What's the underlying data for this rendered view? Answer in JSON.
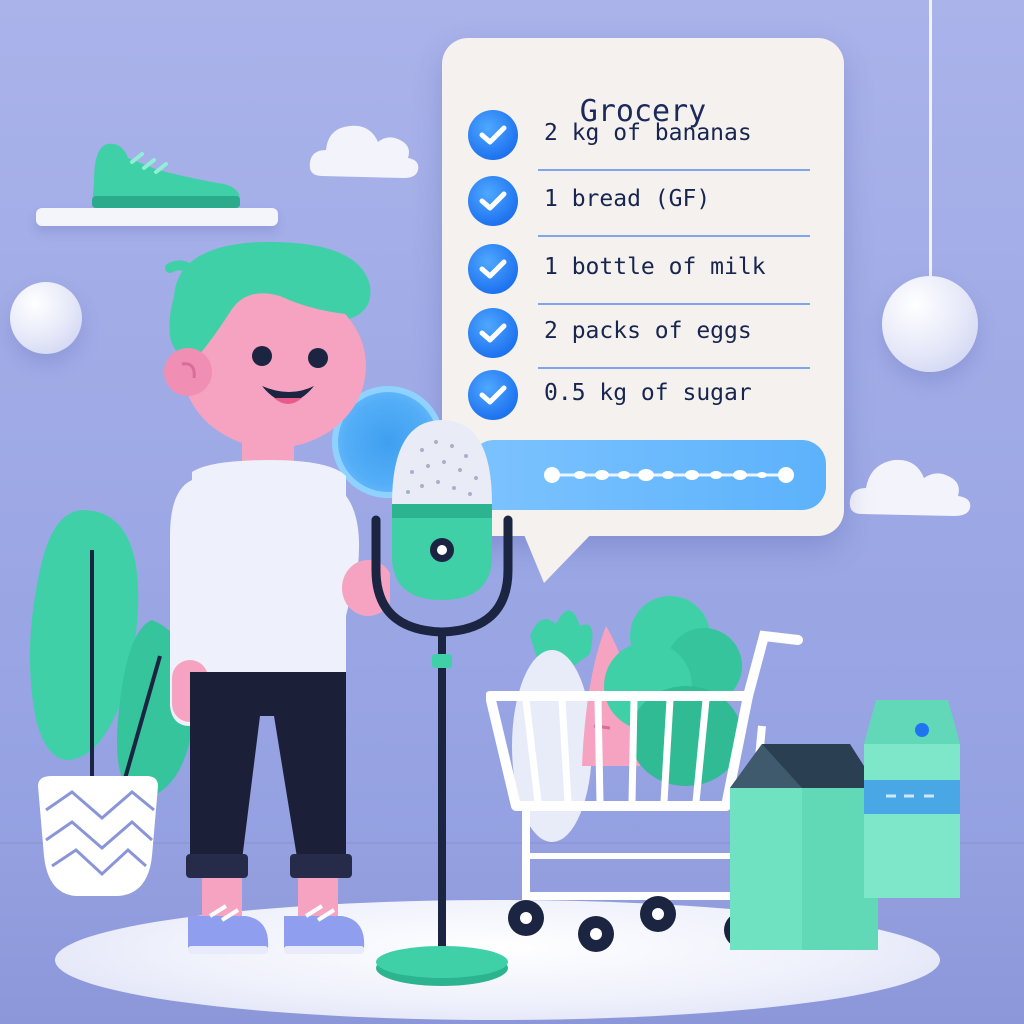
{
  "list": {
    "title": "Grocery",
    "items": [
      {
        "label": "2 kg of bananas",
        "checked": true
      },
      {
        "label": "1 bread (GF)",
        "checked": true
      },
      {
        "label": "1 bottle of milk",
        "checked": true
      },
      {
        "label": "2 packs of eggs",
        "checked": true
      },
      {
        "label": "0.5 kg of sugar",
        "checked": true
      }
    ]
  },
  "icons": {
    "checkmark": "check-circle-icon",
    "voice_wave": "voice-wave-icon",
    "microphone": "microphone-icon"
  },
  "colors": {
    "background": "#9aa6e4",
    "accent_teal": "#3fd0a8",
    "accent_blue": "#1f74f0",
    "bubble": "#f4f1ee",
    "text_dark": "#17254f"
  }
}
